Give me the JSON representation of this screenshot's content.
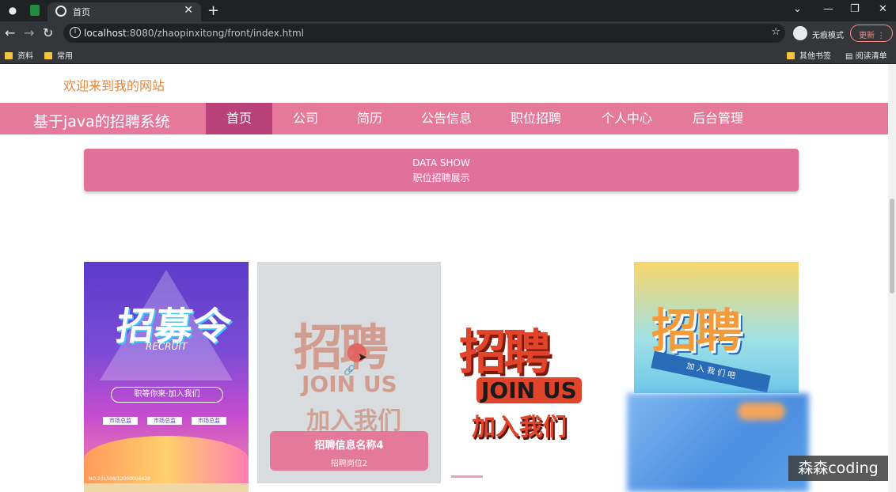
{
  "browser": {
    "tab_title": "首页",
    "url_host": "localhost",
    "url_rest": ":8080/zhaopinxitong/front/index.html",
    "incognito_label": "无痕模式",
    "update_label": "更新",
    "bookmarks": [
      "资料",
      "常用"
    ],
    "bookmarks_right": [
      "其他书签",
      "阅读清单"
    ]
  },
  "header": {
    "welcome": "欢迎来到我的网站",
    "site_title": "基于java的招聘系统",
    "nav": [
      "首页",
      "公司",
      "简历",
      "公告信息",
      "职位招聘",
      "个人中心",
      "后台管理"
    ],
    "active_nav": "首页"
  },
  "datashow": {
    "en": "DATA SHOW",
    "cn": "职位招聘展示"
  },
  "cards": {
    "poster1": {
      "big": "招募令",
      "recruit": "RECRUIT",
      "slogan": "职等你来·加入我们",
      "rows": [
        "市场总监",
        "市场总监",
        "市场总监"
      ],
      "foot": "NO.201508/12000066429"
    },
    "poster2": {
      "word": "招聘",
      "join": "JOIN US",
      "sub": "加入我们",
      "info_title": "招聘信息名称4",
      "info_sub": "招聘岗位2"
    },
    "poster3": {
      "word": "招聘",
      "join": "JOIN US",
      "sub": "加入我们"
    },
    "poster4": {
      "word": "招聘",
      "ribbon": "加 入 我 们 吧"
    }
  },
  "watermark": "森森coding",
  "colors": {
    "nav_bg": "#e5799b",
    "nav_active": "#b8417a",
    "welcome": "#e5853a"
  }
}
